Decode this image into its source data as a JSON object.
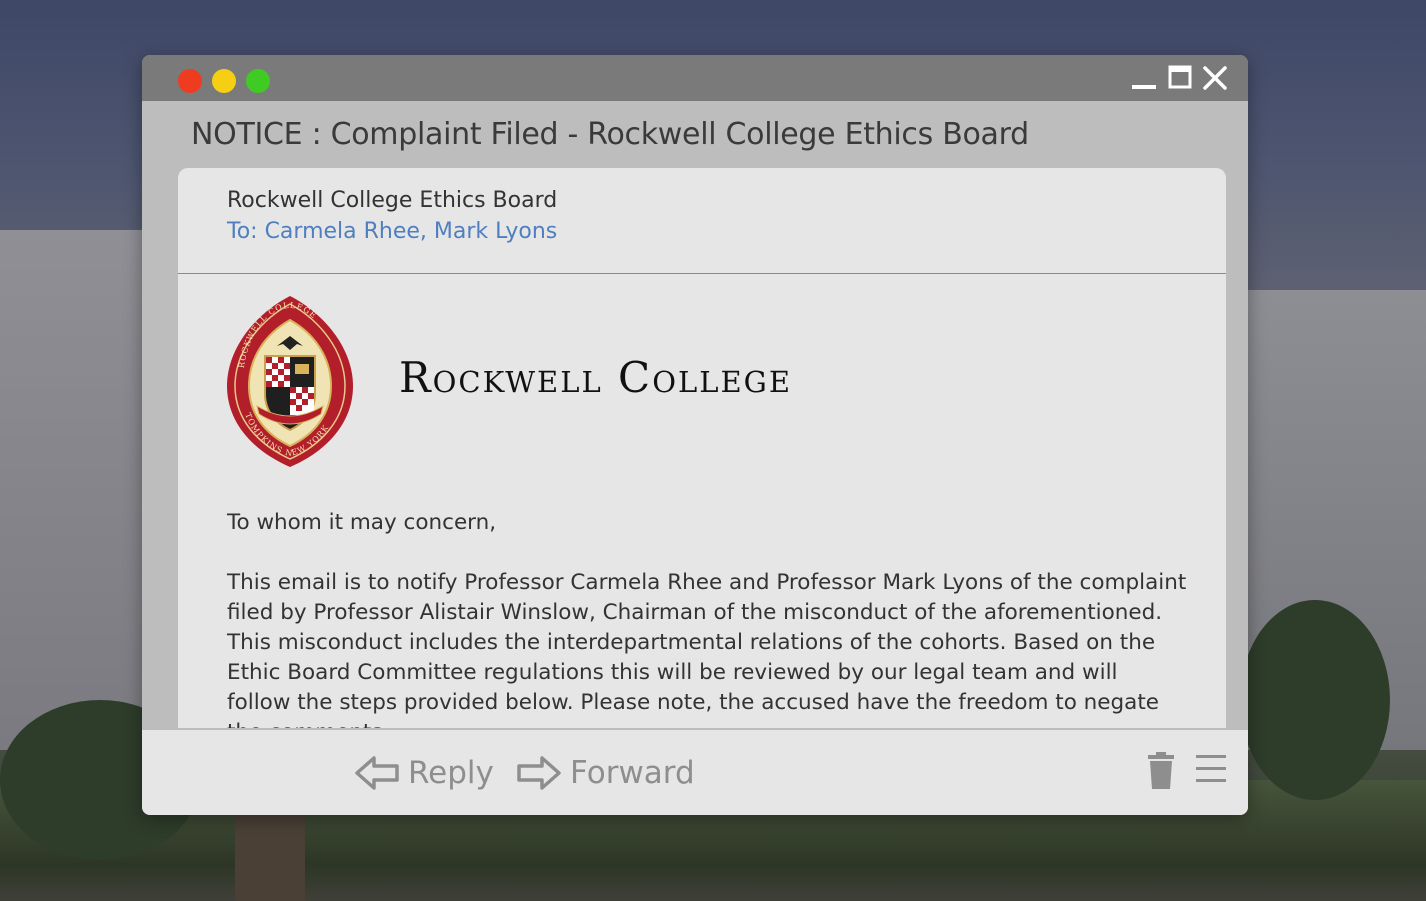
{
  "window": {
    "subject": "NOTICE : Complaint Filed - Rockwell College Ethics Board",
    "controls": [
      "minimize-icon",
      "maximize-icon",
      "close-icon"
    ],
    "traffic_lights": {
      "red": "#ef3b1f",
      "yellow": "#f6cf14",
      "green": "#3fcb23"
    }
  },
  "email": {
    "from": "Rockwell College Ethics Board",
    "to": "To: Carmela Rhee, Mark Lyons",
    "logo": {
      "name": "Rockwell College",
      "seal_text_top": "ROCKWELL COLLEGE",
      "seal_text_bottom": "TOMPKINS NEW YORK"
    },
    "greeting": "To whom it may concern,",
    "body": "This email is to notify Professor Carmela Rhee and Professor Mark Lyons of the complaint filed by Professor Alistair Winslow, Chairman of the misconduct of the aforementioned. This misconduct includes the interdepartmental relations of the cohorts. Based on the Ethic Board Committee regulations this will be reviewed by our legal team and will follow the steps provided below. Please note, the accused have the freedom to negate the comments"
  },
  "toolbar": {
    "reply_label": "Reply",
    "forward_label": "Forward",
    "icons": [
      "reply-arrow-icon",
      "forward-arrow-icon",
      "trash-icon",
      "menu-icon"
    ]
  },
  "colors": {
    "link": "#4f7fc0",
    "seal_red": "#b21f2a",
    "seal_gold": "#d9b25c"
  }
}
